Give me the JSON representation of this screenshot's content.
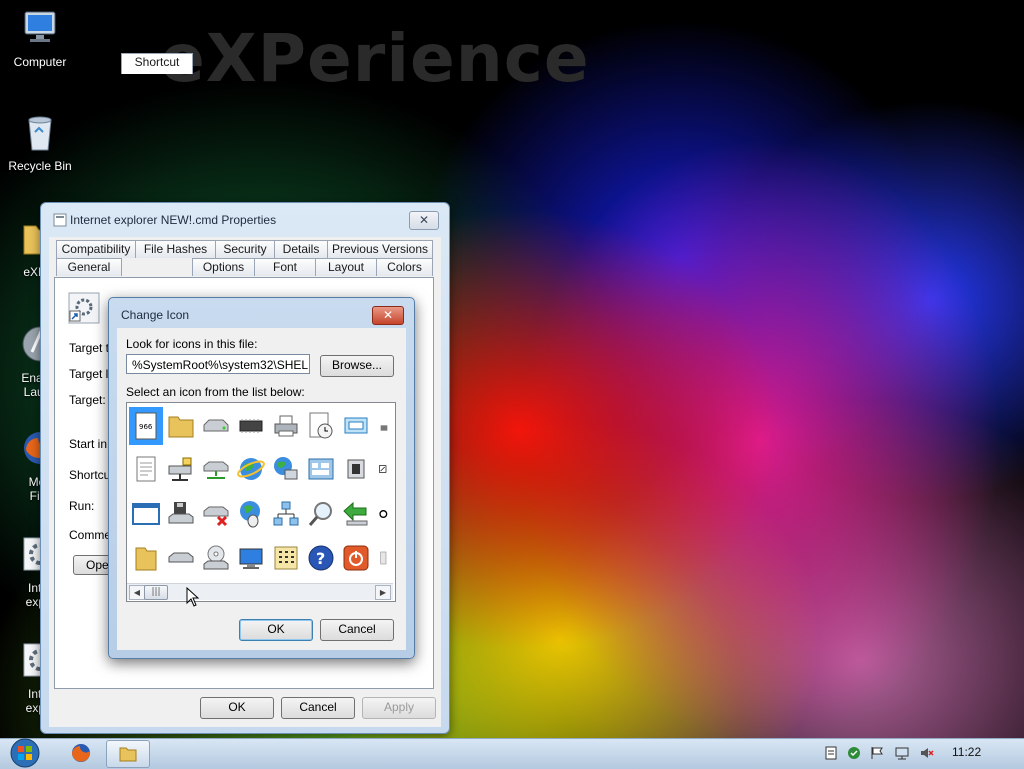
{
  "wallpaper": {
    "brand_text": "eXPerience"
  },
  "desktop_icons": [
    {
      "label": "Computer"
    },
    {
      "label": "Recycle Bin"
    },
    {
      "label": "eXPer"
    },
    {
      "label": "Enable",
      "label2": "Launc"
    },
    {
      "label": "Moz",
      "label2": "Fire"
    },
    {
      "label": "Inter",
      "label2": "explo"
    },
    {
      "label": "Inter",
      "label2": "explo"
    }
  ],
  "properties_window": {
    "title": "Internet explorer NEW!.cmd Properties",
    "tabs_row1": [
      "Compatibility",
      "File Hashes",
      "Security",
      "Details",
      "Previous Versions"
    ],
    "tabs_row2": [
      "General",
      "Shortcut",
      "Options",
      "Font",
      "Layout",
      "Colors"
    ],
    "active_tab": "Shortcut",
    "field_labels": [
      "Target ty",
      "Target lo",
      "Target:",
      "Start in:",
      "Shortcut",
      "Run:",
      "Commer"
    ],
    "open_button_partial": "Oper",
    "buttons": {
      "ok": "OK",
      "cancel": "Cancel",
      "apply": "Apply"
    }
  },
  "change_icon_dialog": {
    "title": "Change Icon",
    "look_label": "Look for icons in this file:",
    "file_path": "%SystemRoot%\\system32\\SHELL32.dll",
    "browse_label": "Browse...",
    "select_label": "Select an icon from the list below:",
    "ok_label": "OK",
    "cancel_label": "Cancel",
    "icons": [
      "file-icon",
      "folder-icon",
      "drive-icon",
      "chip-icon",
      "printer-icon",
      "clock-icon",
      "window-icon",
      "partial-icon",
      "text-file-icon",
      "network-drive-icon",
      "server-drive-icon",
      "globe-icon",
      "network-globe-icon",
      "control-panel-icon",
      "speaker-icon",
      "shortcut-overlay-icon",
      "blank-window-icon",
      "floppy-drive-icon",
      "disconnected-drive-icon",
      "globe-mouse-icon",
      "network-icon",
      "search-icon",
      "back-arrow-icon",
      "sync-overlay-icon",
      "open-folder-icon",
      "hard-drive-icon",
      "cd-drive-icon",
      "desktop-icon",
      "keypad-icon",
      "help-icon",
      "power-icon",
      "partial-icon-2"
    ]
  },
  "taskbar": {
    "clock": "11:22",
    "tray_icons": [
      "notes-icon",
      "security-icon",
      "flag-icon",
      "network-icon",
      "volume-muted-icon"
    ]
  }
}
